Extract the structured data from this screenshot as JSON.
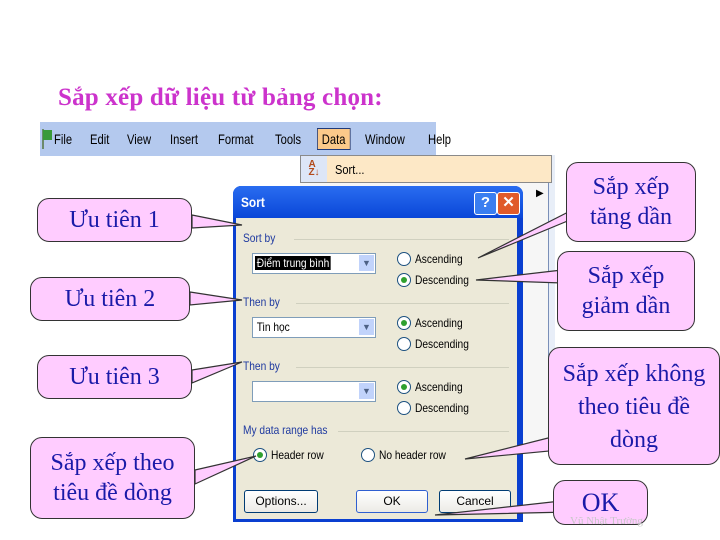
{
  "slide": {
    "title": "Sắp xếp dữ liệu từ bảng chọn:",
    "footer_author": "Vũ Nhật Trường"
  },
  "menubar": {
    "app_icon": "excel-icon",
    "items": [
      "File",
      "Edit",
      "View",
      "Insert",
      "Format",
      "Tools",
      "Data",
      "Window",
      "Help"
    ],
    "active_item": "Data"
  },
  "data_menu": {
    "icon": "sort-az-icon",
    "icon_text": "A Z",
    "items": [
      {
        "label": "Sort..."
      }
    ]
  },
  "sort_dialog": {
    "title": "Sort",
    "help_label": "?",
    "close_label": "✕",
    "sort_by": {
      "label": "Sort by",
      "value": "Điểm trung bình",
      "options": [
        "Ascending",
        "Descending"
      ],
      "selected": "Descending"
    },
    "then_by_1": {
      "label": "Then by",
      "value": "Tin học",
      "options": [
        "Ascending",
        "Descending"
      ],
      "selected": "Ascending"
    },
    "then_by_2": {
      "label": "Then by",
      "value": "",
      "options": [
        "Ascending",
        "Descending"
      ],
      "selected": "Ascending"
    },
    "header": {
      "label": "My data range has",
      "options": [
        "Header row",
        "No header row"
      ],
      "selected": "Header row"
    },
    "buttons": {
      "options": "Options...",
      "ok": "OK",
      "cancel": "Cancel"
    }
  },
  "callouts": {
    "priority1": "Ưu tiên 1",
    "priority2": "Ưu tiên 2",
    "priority3": "Ưu tiên 3",
    "with_header": "Sắp xếp theo tiêu đề dòng",
    "ascending": "Sắp xếp tăng dần",
    "descending": "Sắp xếp giảm dần",
    "no_header": "Sắp xếp không theo tiêu đề dòng",
    "ok": "OK"
  },
  "colors": {
    "title": "#cc33cc",
    "callout_fill": "#ffccff",
    "callout_text": "#1a1aa8",
    "dialog_frame": "#0a3fd0",
    "dialog_body": "#ece9d8"
  }
}
